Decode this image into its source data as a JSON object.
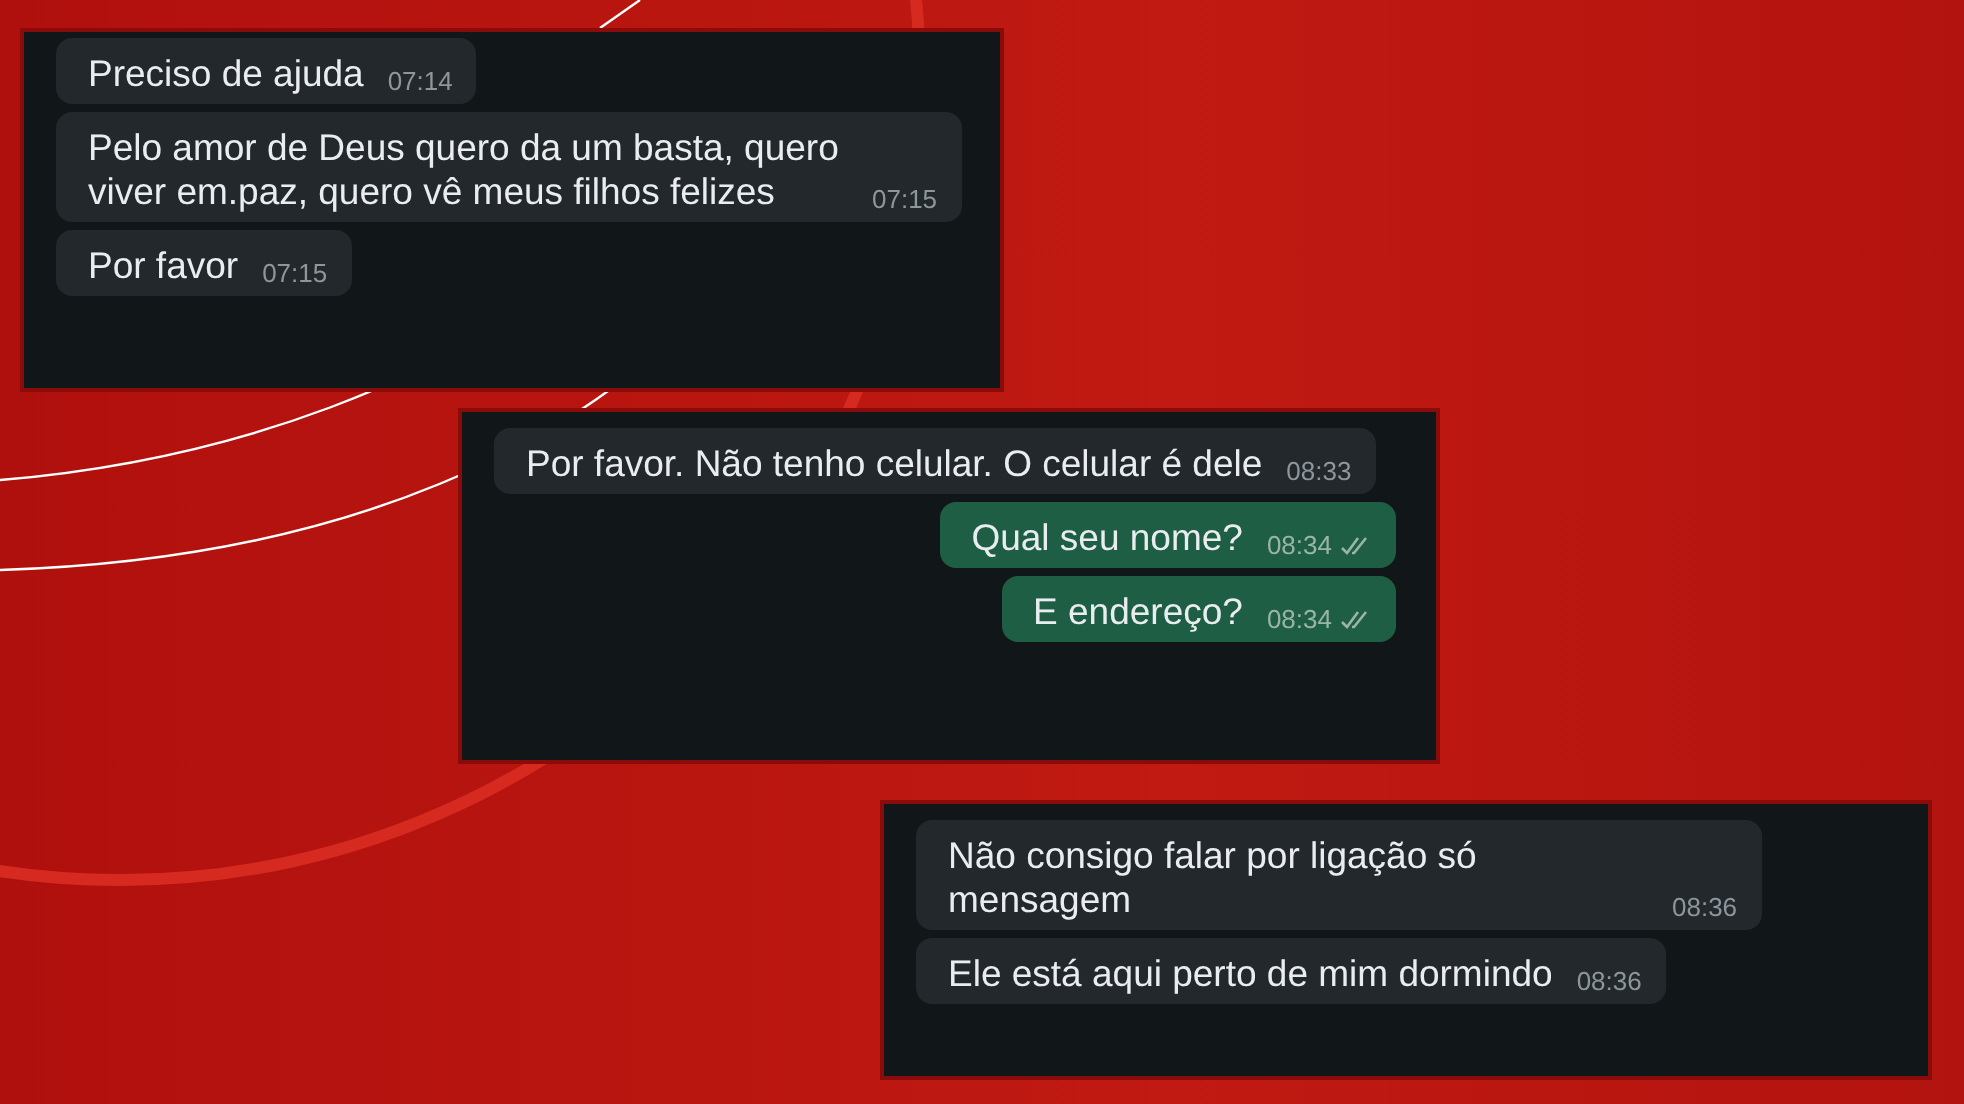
{
  "panels": [
    {
      "messages": [
        {
          "kind": "in",
          "text": "Preciso de ajuda",
          "time": "07:14"
        },
        {
          "kind": "in",
          "text": "Pelo amor de Deus quero da um basta, quero viver em.paz, quero vê meus filhos felizes",
          "time": "07:15"
        },
        {
          "kind": "in",
          "text": "Por favor",
          "time": "07:15"
        }
      ]
    },
    {
      "messages": [
        {
          "kind": "in",
          "text": "Por favor. Não tenho celular.  O celular é dele",
          "time": "08:33"
        },
        {
          "kind": "out",
          "text": "Qual seu nome?",
          "time": "08:34",
          "read": true
        },
        {
          "kind": "out",
          "text": "E endereço?",
          "time": "08:34",
          "read": true
        }
      ]
    },
    {
      "messages": [
        {
          "kind": "in",
          "text": "Não consigo falar por ligação só mensagem",
          "time": "08:36"
        },
        {
          "kind": "in",
          "text": "Ele está aqui perto de mim dormindo",
          "time": "08:36"
        }
      ]
    }
  ]
}
